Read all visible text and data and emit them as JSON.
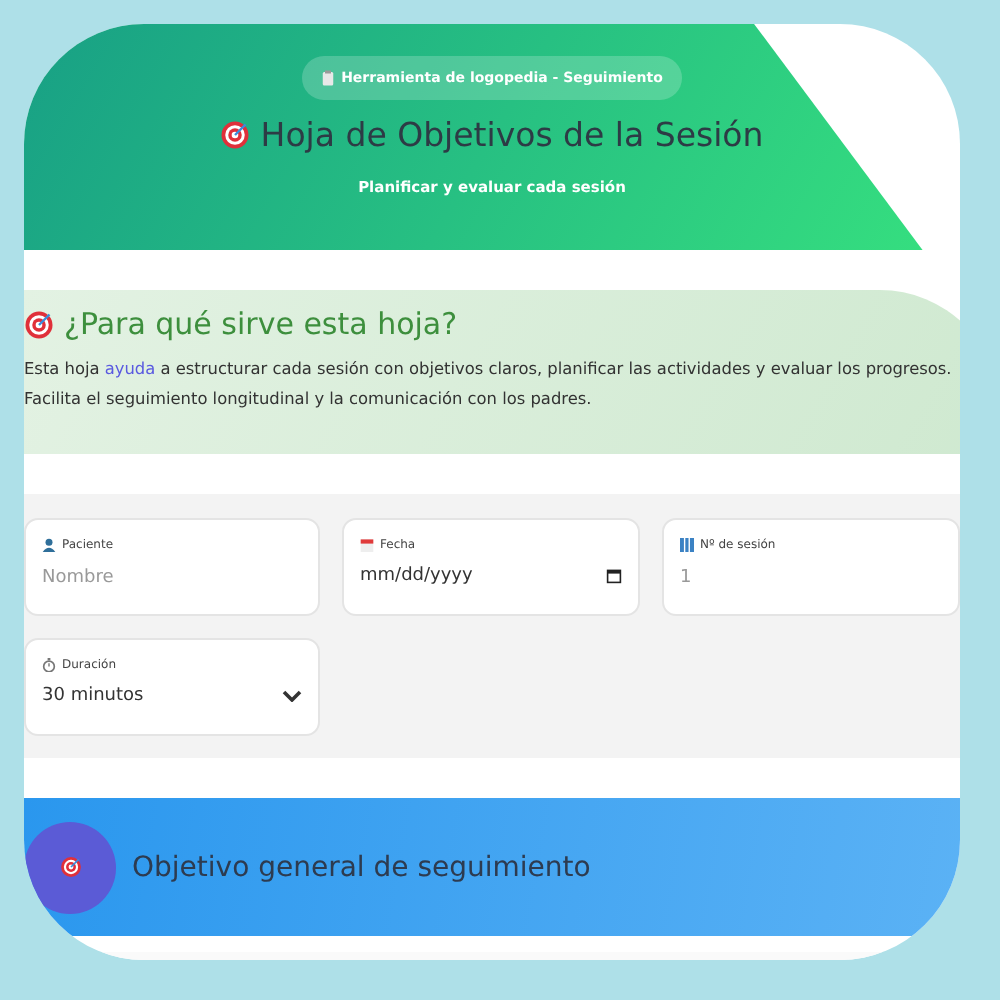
{
  "header": {
    "badge": "Herramienta de logopedia - Seguimiento",
    "title": "Hoja de Objetivos de la Sesión",
    "subtitle": "Planificar y evaluar cada sesión"
  },
  "info": {
    "title": "¿Para qué sirve esta hoja?",
    "text": "Esta hoja ",
    "link": "ayuda",
    "text_after": " a estructurar cada sesión con objetivos claros, planificar las actividades y evaluar los progresos. Facilita el seguimiento longitudinal y la comunicación con los padres."
  },
  "fields": [
    {
      "kind": "text",
      "label": "Paciente",
      "placeholder": "Nombre"
    },
    {
      "kind": "date",
      "label": "Fecha",
      "value": "mm/dd/yyyy"
    },
    {
      "kind": "number",
      "label": "Nº de sesión",
      "placeholder": "1"
    },
    {
      "kind": "select",
      "label": "Duración",
      "value": "30 minutos"
    }
  ],
  "section": {
    "title": "Objetivo general de seguimiento"
  }
}
